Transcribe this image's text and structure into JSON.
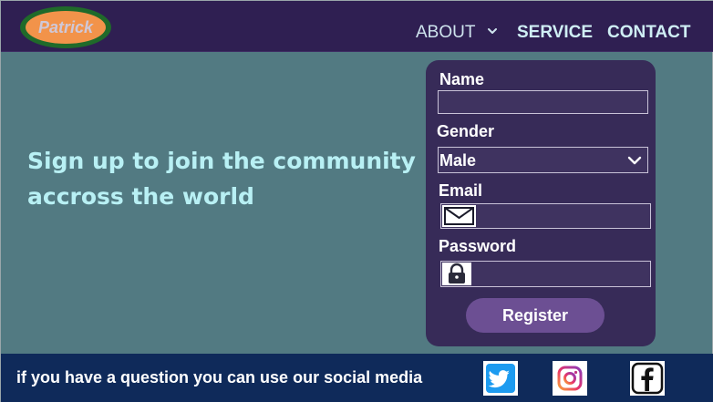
{
  "header": {
    "logo_text": "Patrick",
    "nav": {
      "about": "ABOUT",
      "service": "SERVICE",
      "contact": "CONTACT"
    }
  },
  "hero": {
    "line1": "Sign up to join the community",
    "line2": "accross the world"
  },
  "form": {
    "name_label": "Name",
    "name_value": "",
    "gender_label": "Gender",
    "gender_selected": "Male",
    "email_label": "Email",
    "email_value": "",
    "password_label": "Password",
    "password_value": "",
    "register_label": "Register"
  },
  "footer": {
    "text": "if you have a question you can use our social media",
    "icons": [
      "twitter-icon",
      "instagram-icon",
      "facebook-icon"
    ]
  },
  "colors": {
    "header_bg": "#2f1f52",
    "body_bg": "#527a82",
    "card_bg": "#372b58",
    "button_bg": "#6c4f93",
    "footer_bg": "#0f2a5a",
    "hero_text": "#b8f0f4",
    "logo_fill": "#f2934a",
    "logo_ring": "#1f6a2a"
  }
}
